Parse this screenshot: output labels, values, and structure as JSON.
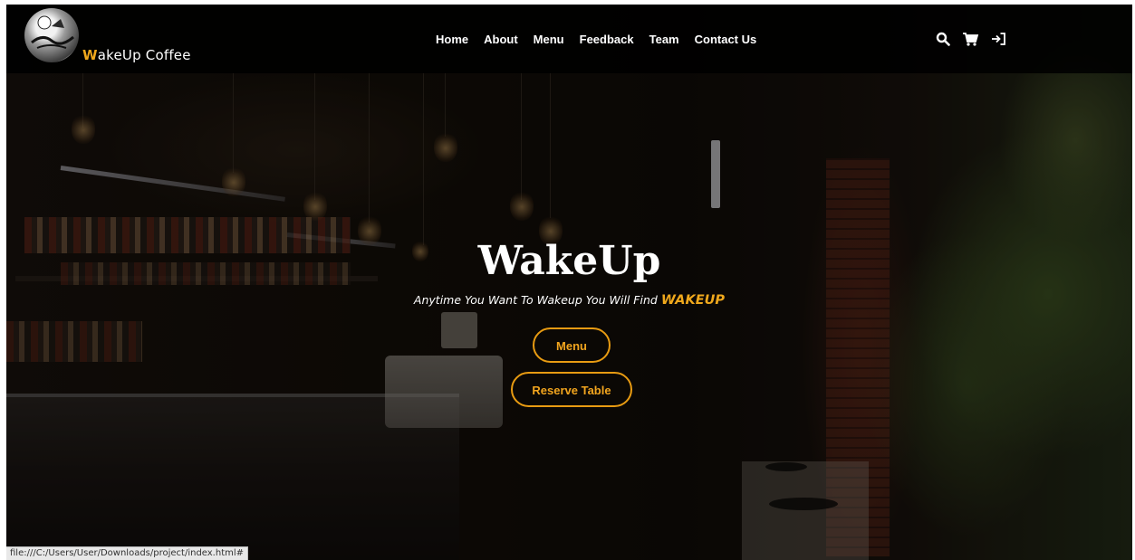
{
  "brand": {
    "name_first_letter": "W",
    "name_rest": "akeUp Coffee"
  },
  "nav": {
    "items": [
      {
        "label": "Home"
      },
      {
        "label": "About"
      },
      {
        "label": "Menu"
      },
      {
        "label": "Feedback"
      },
      {
        "label": "Team"
      },
      {
        "label": "Contact Us"
      }
    ]
  },
  "header_actions": {
    "search_icon": "search-icon",
    "cart_icon": "cart-icon",
    "login_icon": "sign-in-icon"
  },
  "hero": {
    "title": "WakeUp",
    "subtitle_prefix": "Anytime You Want To Wakeup You Will Find ",
    "subtitle_highlight": "WAKEUP",
    "menu_button": "Menu",
    "reserve_button": "Reserve Table"
  },
  "statusbar": {
    "url": "file:///C:/Users/User/Downloads/project/index.html#"
  },
  "colors": {
    "accent": "#f0a81c",
    "header_bg": "#000000",
    "text": "#ffffff"
  }
}
